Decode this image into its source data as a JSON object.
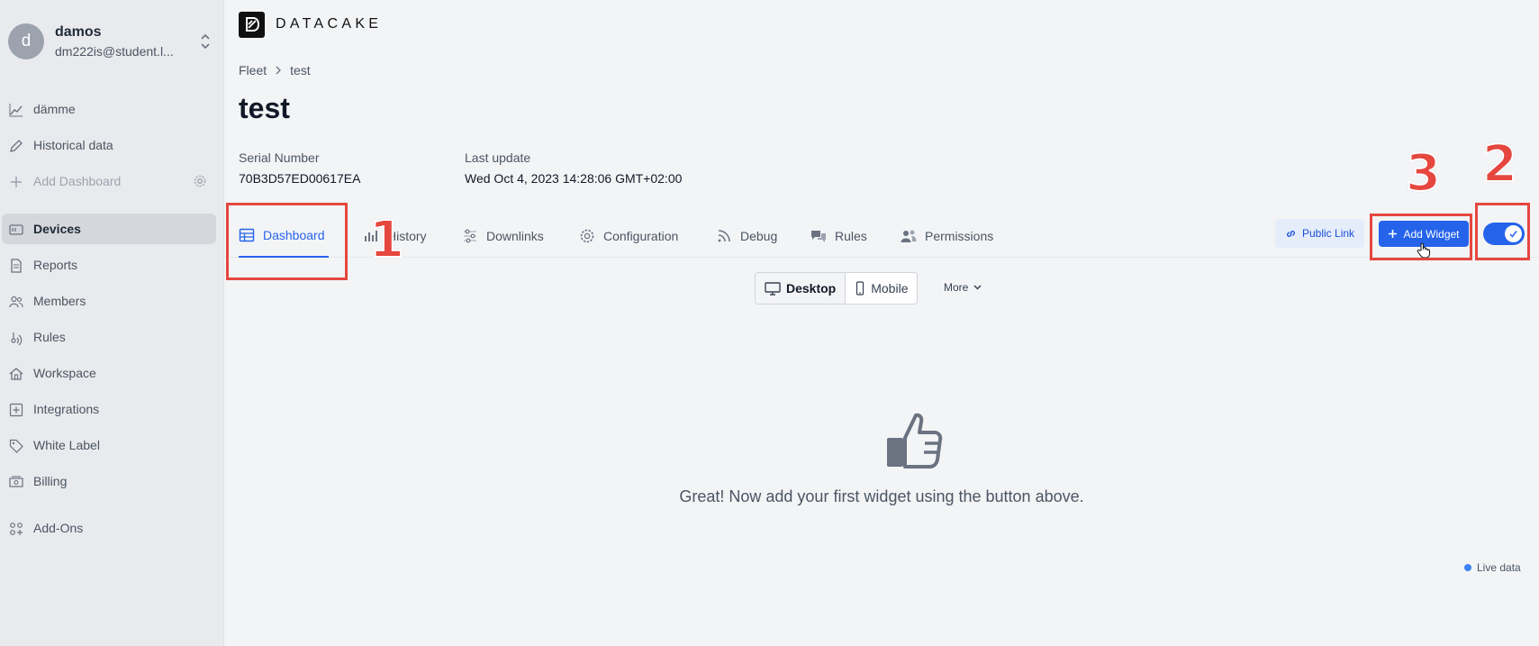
{
  "user": {
    "initial": "d",
    "name": "damos",
    "email": "dm222is@student.l..."
  },
  "sidebar": {
    "items": [
      {
        "label": "dämme",
        "icon": "chart-line-icon"
      },
      {
        "label": "Historical data",
        "icon": "pencil-icon"
      },
      {
        "label": "Add Dashboard",
        "icon": "plus-icon"
      },
      {
        "label": "Devices",
        "icon": "device-icon"
      },
      {
        "label": "Reports",
        "icon": "document-icon"
      },
      {
        "label": "Members",
        "icon": "users-icon"
      },
      {
        "label": "Rules",
        "icon": "signal-icon"
      },
      {
        "label": "Workspace",
        "icon": "home-icon"
      },
      {
        "label": "Integrations",
        "icon": "plus-square-icon"
      },
      {
        "label": "White Label",
        "icon": "tag-icon"
      },
      {
        "label": "Billing",
        "icon": "cash-icon"
      },
      {
        "label": "Add-Ons",
        "icon": "apps-icon"
      }
    ]
  },
  "header": {
    "logo_text": "DATACAKE"
  },
  "breadcrumb": {
    "parent": "Fleet",
    "current": "test"
  },
  "page": {
    "title": "test"
  },
  "meta": {
    "serial_label": "Serial Number",
    "serial_value": "70B3D57ED00617EA",
    "update_label": "Last update",
    "update_value": "Wed Oct 4, 2023 14:28:06 GMT+02:00"
  },
  "tabs": [
    {
      "label": "Dashboard",
      "icon": "table-icon"
    },
    {
      "label": "History",
      "icon": "bar-chart-icon"
    },
    {
      "label": "Downlinks",
      "icon": "sliders-icon"
    },
    {
      "label": "Configuration",
      "icon": "gear-icon"
    },
    {
      "label": "Debug",
      "icon": "rss-icon"
    },
    {
      "label": "Rules",
      "icon": "chat-icon"
    },
    {
      "label": "Permissions",
      "icon": "users-icon"
    }
  ],
  "actions": {
    "public_link": "Public Link",
    "add_widget": "Add Widget"
  },
  "view": {
    "desktop": "Desktop",
    "mobile": "Mobile",
    "more": "More"
  },
  "empty_state": {
    "message": "Great! Now add your first widget using the button above."
  },
  "live_data": "Live data",
  "annotations": [
    "1",
    "2",
    "3"
  ],
  "colors": {
    "accent": "#2563eb",
    "annotation": "#e5473f"
  }
}
